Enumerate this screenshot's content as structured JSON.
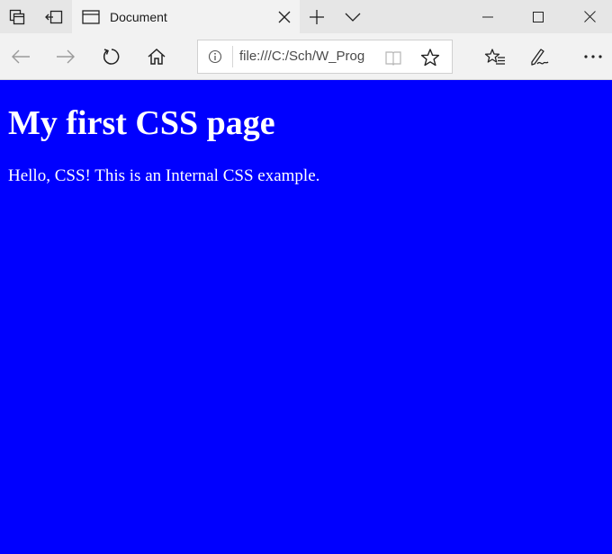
{
  "browser": {
    "tab": {
      "title": "Document"
    },
    "address_bar": {
      "url": "file:///C:/Sch/W_Prog"
    },
    "icons": {
      "tab_manager": "tab-manager-icon",
      "set_aside": "set-aside-tabs-icon",
      "page": "page-icon",
      "close_tab": "close-icon",
      "new_tab": "plus-icon",
      "tab_preview": "chevron-down-icon",
      "minimize": "minimize-icon",
      "maximize": "maximize-icon",
      "close_window": "close-icon",
      "back": "back-arrow-icon",
      "forward": "forward-arrow-icon",
      "refresh": "refresh-icon",
      "home": "home-icon",
      "info": "info-icon",
      "reading_view": "reading-view-icon",
      "favorite": "star-icon",
      "favorites_hub": "favorites-hub-icon",
      "web_note": "pen-icon",
      "more": "more-icon"
    }
  },
  "page": {
    "heading": "My first CSS page",
    "paragraph": "Hello, CSS! This is an Internal CSS example.",
    "background_color": "#0000ff",
    "text_color": "#ffffff"
  }
}
